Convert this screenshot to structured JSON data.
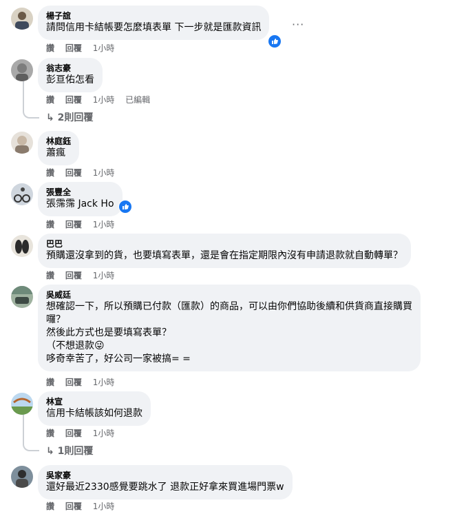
{
  "comments": [
    {
      "name": "楊子誼",
      "text": "請問信用卡結帳要怎麼填表單 下一步就是匯款資訊",
      "like": "讚",
      "reply": "回覆",
      "time": "1小時"
    },
    {
      "name": "翁志豪",
      "text": "彭亘佑怎看",
      "like": "讚",
      "reply": "回覆",
      "time": "1小時",
      "edited": "已編輯",
      "replies": "2則回覆"
    },
    {
      "name": "林庭鈺",
      "text": "蕭瘋",
      "like": "讚",
      "reply": "回覆",
      "time": "1小時"
    },
    {
      "name": "張豐全",
      "text": "張霈霈 Jack Ho",
      "like": "讚",
      "reply": "回覆",
      "time": "1小時"
    },
    {
      "name": "巴巴",
      "text": "預購還沒拿到的貨，也要填寫表單，還是會在指定期限內沒有申請退款就自動轉單？",
      "like": "讚",
      "reply": "回覆",
      "time": "1小時"
    },
    {
      "name": "吳威廷",
      "text_lines": [
        "想確認一下，所以預購已付款（匯款）的商品，可以由你們協助後續和供貨商直接購買",
        "囉？",
        "然後此方式也是要填寫表單？",
        "（不想退款😜",
        "哆奇幸苦了，好公司一家被搞= ="
      ],
      "like": "讚",
      "reply": "回覆",
      "time": "1小時"
    },
    {
      "name": "林宣",
      "text": "信用卡結帳該如何退款",
      "like": "讚",
      "reply": "回覆",
      "time": "1小時",
      "replies": "1則回覆"
    },
    {
      "name": "吳家豪",
      "text": "還好最近2330感覺要跳水了 退款正好拿來買進場門票w",
      "like": "讚",
      "reply": "回覆",
      "time": "1小時"
    }
  ],
  "more_label": "···",
  "colors": {
    "bubble": "#f0f2f5",
    "meta": "#65676b",
    "like_blue": "#1877f2"
  }
}
